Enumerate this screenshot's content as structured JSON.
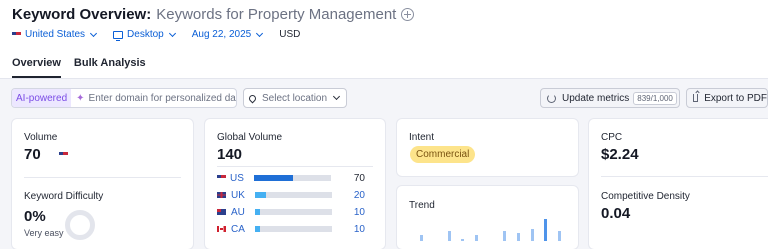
{
  "header": {
    "title": "Keyword Overview:",
    "keyword": "Keywords for Property Management"
  },
  "filters": {
    "country": "United States",
    "device": "Desktop",
    "date": "Aug 22, 2025",
    "currency": "USD"
  },
  "tabs": [
    {
      "label": "Overview",
      "active": true
    },
    {
      "label": "Bulk Analysis",
      "active": false
    }
  ],
  "toolbar": {
    "ai_badge": "AI-powered",
    "domain_placeholder": "Enter domain for personalized data",
    "location_placeholder": "Select location",
    "update_label": "Update metrics",
    "update_count": "839/1,000",
    "export_label": "Export to PDF"
  },
  "volume": {
    "label": "Volume",
    "value": "70"
  },
  "difficulty": {
    "label": "Keyword Difficulty",
    "value": "0%",
    "desc": "Very easy",
    "percent": 0
  },
  "global_volume": {
    "label": "Global Volume",
    "value": "140",
    "rows": [
      {
        "code": "US",
        "value": "70",
        "share": 0.5,
        "color": "#1f6fd6"
      },
      {
        "code": "UK",
        "value": "20",
        "share": 0.14,
        "color": "#45b0f2"
      },
      {
        "code": "AU",
        "value": "10",
        "share": 0.07,
        "color": "#45b0f2"
      },
      {
        "code": "CA",
        "value": "10",
        "share": 0.07,
        "color": "#45b0f2"
      }
    ]
  },
  "intent": {
    "label": "Intent",
    "value": "Commercial"
  },
  "trend": {
    "label": "Trend",
    "values": [
      3,
      0,
      5,
      1,
      3,
      0,
      5,
      4,
      6,
      11,
      5
    ]
  },
  "cpc": {
    "label": "CPC",
    "value": "$2.24"
  },
  "density": {
    "label": "Competitive Density",
    "value": "0.04"
  }
}
